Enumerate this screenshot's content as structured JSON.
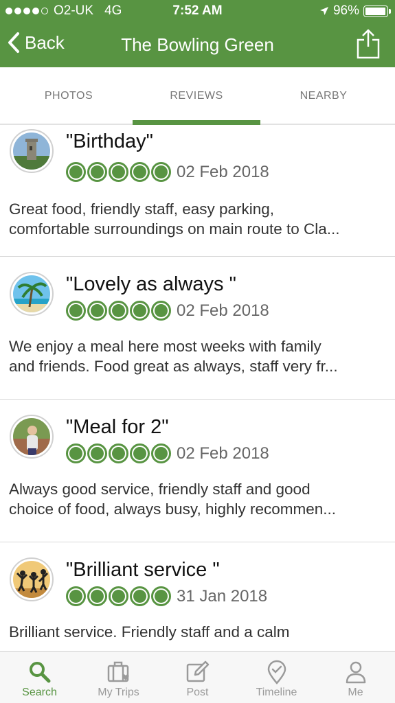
{
  "status_bar": {
    "carrier": "O2-UK",
    "network": "4G",
    "time": "7:52 AM",
    "battery": "96%",
    "battery_level": 0.96
  },
  "nav": {
    "back_label": "Back",
    "title": "The Bowling Green"
  },
  "tabs": [
    {
      "label": "PHOTOS"
    },
    {
      "label": "REVIEWS"
    },
    {
      "label": "NEARBY"
    }
  ],
  "active_tab": "REVIEWS",
  "reviews": [
    {
      "title": "\"Birthday\"",
      "rating": 5,
      "date": "02 Feb 2018",
      "snippet_line1": "Great food, friendly staff, easy parking,",
      "snippet_line2": "comfortable surroundings on main route to Cla...",
      "avatar": "castle-tower"
    },
    {
      "title": "\"Lovely as always \"",
      "rating": 5,
      "date": "02 Feb 2018",
      "snippet_line1": "We enjoy a meal here most weeks with family",
      "snippet_line2": "and friends. Food great as always, staff very fr...",
      "avatar": "palm-beach"
    },
    {
      "title": "\"Meal for 2\"",
      "rating": 5,
      "date": "02 Feb 2018",
      "snippet_line1": "Always good service, friendly staff and good",
      "snippet_line2": "choice of food, always busy, highly recommen...",
      "avatar": "person-portrait"
    },
    {
      "title": "\"Brilliant service \"",
      "rating": 5,
      "date": "31 Jan 2018",
      "snippet_line1": "Brilliant service. Friendly staff and a calm",
      "snippet_line2": "",
      "avatar": "silhouettes-sunset"
    }
  ],
  "bottom_tabs": [
    {
      "label": "Search",
      "icon": "search-icon"
    },
    {
      "label": "My Trips",
      "icon": "suitcase-heart-icon"
    },
    {
      "label": "Post",
      "icon": "edit-icon"
    },
    {
      "label": "Timeline",
      "icon": "location-check-icon"
    },
    {
      "label": "Me",
      "icon": "person-icon"
    }
  ],
  "active_bottom_tab": "Search",
  "colors": {
    "brand_green": "#589442",
    "text": "#333333",
    "muted": "#9a9a9a"
  }
}
